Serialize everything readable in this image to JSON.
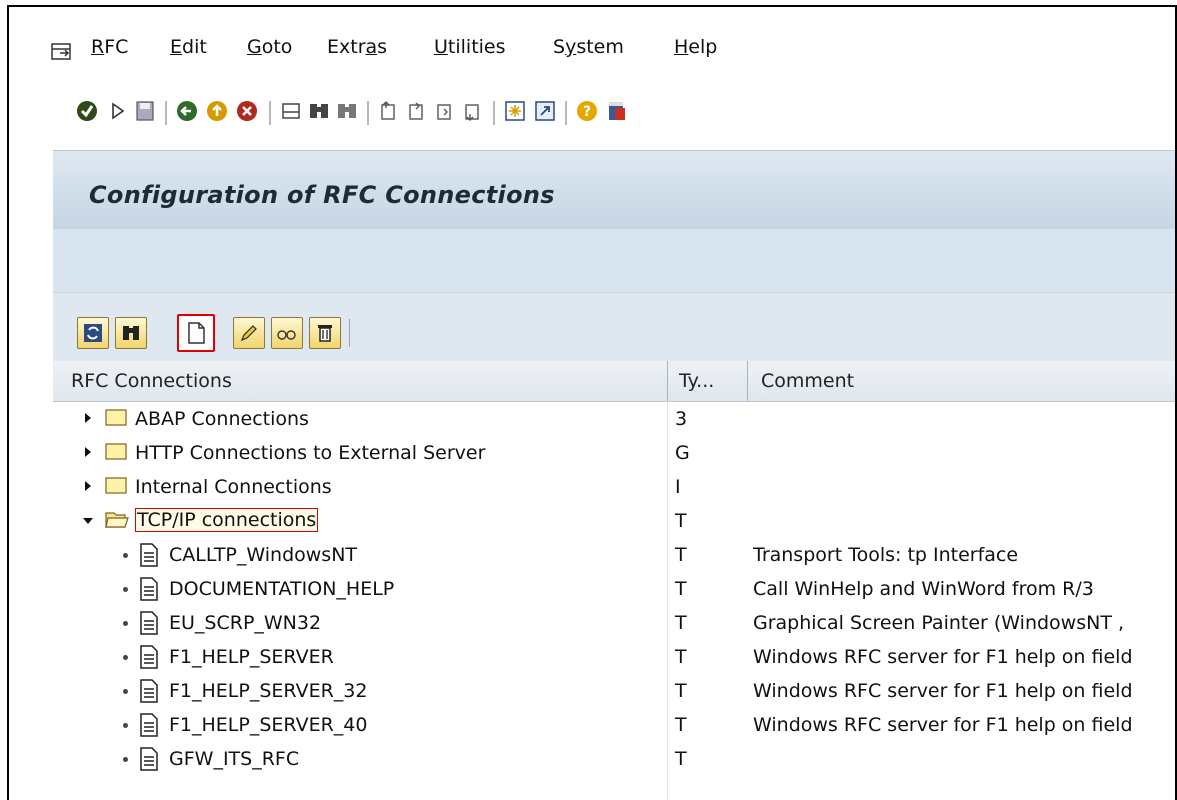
{
  "menu": {
    "items": [
      "RFC",
      "Edit",
      "Goto",
      "Extras",
      "Utilities",
      "System",
      "Help"
    ]
  },
  "toolbar": {
    "icons": [
      "enter-icon",
      "play-icon",
      "save-icon",
      "back-icon",
      "exit-icon",
      "cancel-icon",
      "print-icon",
      "find-icon",
      "find-next-icon",
      "first-page-icon",
      "previous-page-icon",
      "next-page-icon",
      "last-page-icon",
      "create-session-icon",
      "shortcut-icon",
      "help-icon",
      "customize-layout-icon"
    ]
  },
  "page": {
    "title": "Configuration of RFC Connections"
  },
  "alv_toolbar": {
    "buttons": [
      "refresh-icon",
      "find-icon",
      "create-icon",
      "edit-icon",
      "display-icon",
      "delete-icon"
    ],
    "highlighted": "create-icon"
  },
  "table": {
    "headers": [
      "RFC Connections",
      "Ty...",
      "Comment"
    ],
    "rows": [
      {
        "kind": "folder",
        "expanded": false,
        "name": "ABAP Connections",
        "type": "3",
        "comment": ""
      },
      {
        "kind": "folder",
        "expanded": false,
        "name": "HTTP Connections to External Server",
        "type": "G",
        "comment": ""
      },
      {
        "kind": "folder",
        "expanded": false,
        "name": "Internal Connections",
        "type": "I",
        "comment": ""
      },
      {
        "kind": "folder",
        "expanded": true,
        "name": "TCP/IP connections",
        "type": "T",
        "comment": ""
      },
      {
        "kind": "item",
        "name": "CALLTP_WindowsNT",
        "type": "T",
        "comment": "Transport Tools: tp Interface"
      },
      {
        "kind": "item",
        "name": "DOCUMENTATION_HELP",
        "type": "T",
        "comment": "Call WinHelp and WinWord from R/3"
      },
      {
        "kind": "item",
        "name": "EU_SCRP_WN32",
        "type": "T",
        "comment": "Graphical Screen Painter (WindowsNT ,"
      },
      {
        "kind": "item",
        "name": "F1_HELP_SERVER",
        "type": "T",
        "comment": "Windows RFC server for F1 help on field"
      },
      {
        "kind": "item",
        "name": "F1_HELP_SERVER_32",
        "type": "T",
        "comment": "Windows RFC server for F1 help on field"
      },
      {
        "kind": "item",
        "name": "F1_HELP_SERVER_40",
        "type": "T",
        "comment": "Windows RFC server for F1 help on field"
      },
      {
        "kind": "item",
        "name": "GFW_ITS_RFC",
        "type": "T",
        "comment": ""
      }
    ]
  },
  "colors": {
    "highlight": "#e00000",
    "title_bg": "#c6d6e4",
    "folder": "#f2d46a"
  }
}
